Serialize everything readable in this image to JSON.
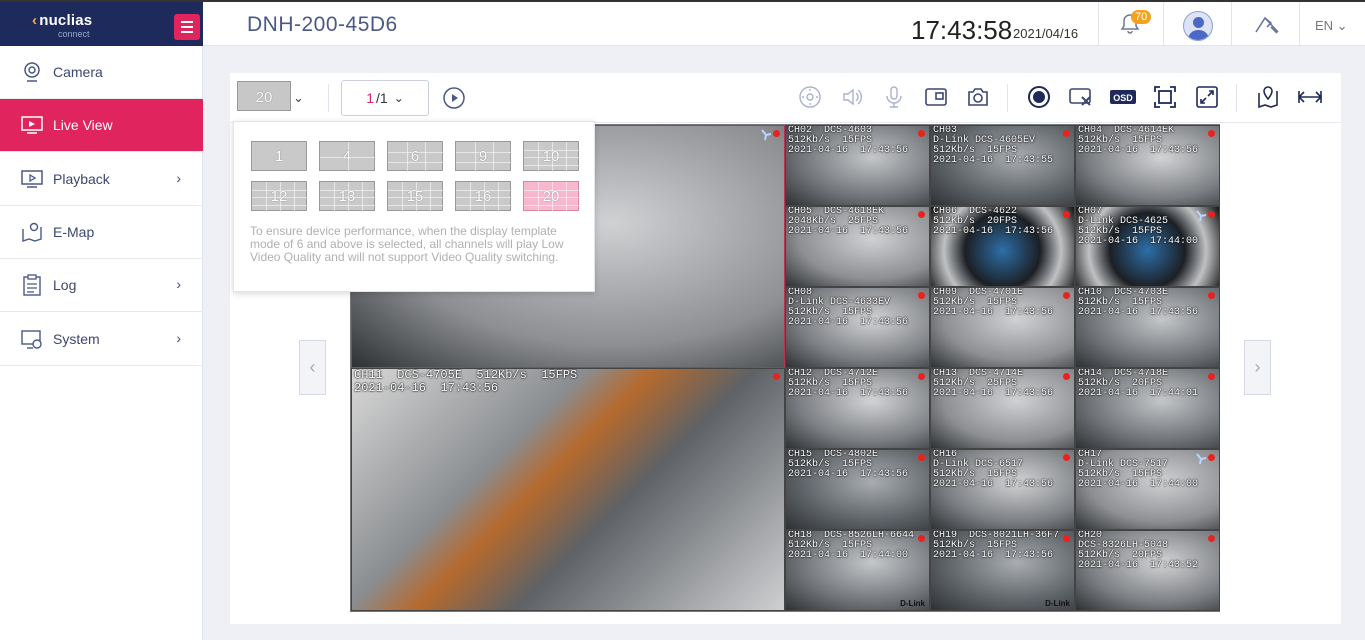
{
  "brand": {
    "name": "nuclias",
    "sub": "connect"
  },
  "header": {
    "device_name": "DNH-200-45D6",
    "time": "17:43:58",
    "date": "2021/04/16",
    "notification_count": "70",
    "language": "EN"
  },
  "sidebar": {
    "items": [
      {
        "label": "Camera",
        "icon": "camera-icon",
        "active": false,
        "has_arrow": false
      },
      {
        "label": "Live View",
        "icon": "live-view-icon",
        "active": true,
        "has_arrow": false
      },
      {
        "label": "Playback",
        "icon": "playback-icon",
        "active": false,
        "has_arrow": true
      },
      {
        "label": "E-Map",
        "icon": "emap-icon",
        "active": false,
        "has_arrow": false
      },
      {
        "label": "Log",
        "icon": "log-icon",
        "active": false,
        "has_arrow": true
      },
      {
        "label": "System",
        "icon": "system-icon",
        "active": false,
        "has_arrow": true
      }
    ]
  },
  "toolbar": {
    "layout_value": "20",
    "page_current": "1",
    "page_total": "/1",
    "icons": [
      "ptz-icon",
      "speaker-icon",
      "microphone-icon",
      "snapshot-window-icon",
      "camera-snapshot-icon",
      "record-icon",
      "video-off-icon",
      "osd-icon",
      "fit-screen-icon",
      "fullscreen-icon",
      "map-pin-icon",
      "expand-icon"
    ]
  },
  "layout_menu": {
    "options": [
      "1",
      "4",
      "6",
      "9",
      "10",
      "12",
      "13",
      "15",
      "16",
      "20"
    ],
    "selected": "20",
    "note": "To ensure device performance, when the display template mode of 6 and above is selected, all channels will play Low Video Quality and will not support Video Quality switching."
  },
  "channels": [
    {
      "label": "5FPS",
      "rec": true,
      "fav": true
    },
    {
      "label": "CH02  DCS-4603\n512Kb/s  15FPS\n2021-04-16  17:43:56",
      "rec": true,
      "fav": false
    },
    {
      "label": "CH03\nD-Link DCS-4605EV\n512Kb/s  15FPS\n2021-04-16  17:43:55",
      "rec": true,
      "fav": false
    },
    {
      "label": "CH04  DCS-4614EK\n512Kb/s  15FPS\n2021-04-16  17:43:56",
      "rec": true,
      "fav": false
    },
    {
      "label": "CH05  DCS-4618EK\n2048Kb/s  25FPS\n2021-04-16  17:43:56",
      "rec": true,
      "fav": false
    },
    {
      "label": "CH06  DCS-4622\n512Kb/s  20FPS\n2021-04-16  17:43:56",
      "rec": true,
      "fav": false
    },
    {
      "label": "CH07\nD-Link DCS-4625\n512Kb/s  15FPS\n2021-04-16  17:44:00",
      "rec": true,
      "fav": true
    },
    {
      "label": "CH08\nD-Link DCS-4633EV\n512Kb/s  15FPS\n2021-04-16  17:43:56",
      "rec": true,
      "fav": false
    },
    {
      "label": "CH09  DCS-4701E\n512Kb/s  15FPS\n2021-04-16  17:43:56",
      "rec": true,
      "fav": false
    },
    {
      "label": "CH10  DCS-4703E\n512Kb/s  15FPS\n2021-04-16  17:43:56",
      "rec": true,
      "fav": false
    },
    {
      "label": "CH11  DCS-4705E  512Kb/s  15FPS\n2021-04-16  17:43:56",
      "rec": true,
      "fav": false
    },
    {
      "label": "CH12  DCS-4712E\n512Kb/s  15FPS\n2021-04-16  17:43:56",
      "rec": true,
      "fav": false
    },
    {
      "label": "CH13  DCS-4714E\n512Kb/s  25FPS\n2021-04-16  17:43:56",
      "rec": true,
      "fav": false
    },
    {
      "label": "CH14  DCS-4718E\n512Kb/s  20FPS\n2021-04-16  17:44:01",
      "rec": true,
      "fav": false
    },
    {
      "label": "CH15  DCS-4802E\n512Kb/s  15FPS\n2021-04-16  17:43:56",
      "rec": true,
      "fav": false
    },
    {
      "label": "CH16\nD-Link DCS-6517\n512Kb/s  15FPS\n2021-04-16  17:43:56",
      "rec": true,
      "fav": false
    },
    {
      "label": "CH17\nD-Link DCS-7517\n512Kb/s  15FPS\n2021-04-16  17:44:00",
      "rec": true,
      "fav": true
    },
    {
      "label": "CH18  DCS-8526LH-6644\n512Kb/s  15FPS\n2021-04-16  17:44:00",
      "rec": true,
      "fav": false
    },
    {
      "label": "CH19  DCS-8021LH-36F7\n512Kb/s  15FPS\n2021-04-16  17:43:56",
      "rec": true,
      "fav": false
    },
    {
      "label": "CH20\nDCS-8326LH-5048\n512Kb/s  20FPS\n2021-04-16  17:43:52",
      "rec": true,
      "fav": false
    }
  ],
  "watermark": "D-Link"
}
